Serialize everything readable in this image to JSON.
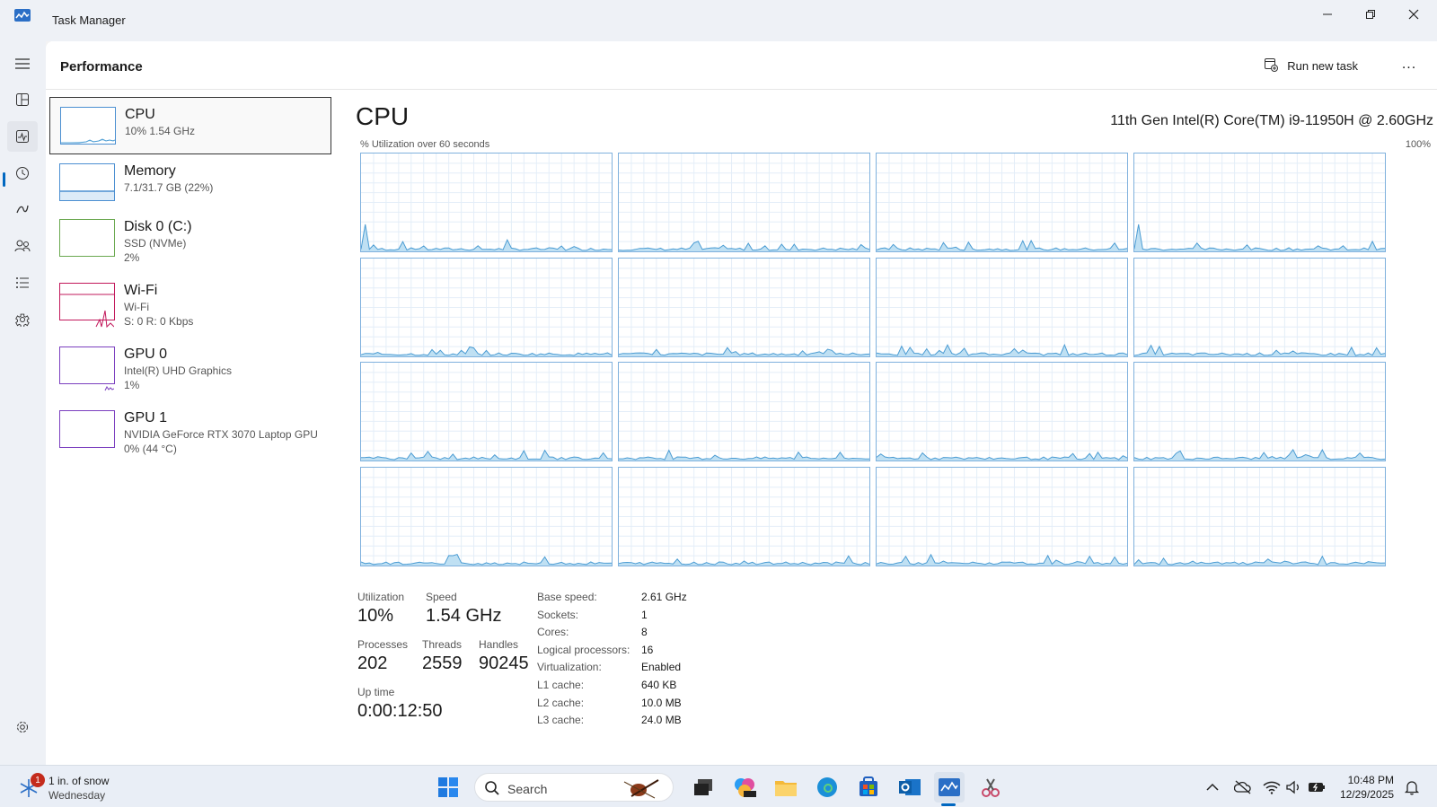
{
  "window": {
    "title": "Task Manager"
  },
  "header": {
    "page_title": "Performance",
    "run_new_task": "Run new task",
    "more": "..."
  },
  "resources": [
    {
      "name": "CPU",
      "line1": "10% 1.54 GHz",
      "line2": ""
    },
    {
      "name": "Memory",
      "line1": "7.1/31.7 GB (22%)",
      "line2": ""
    },
    {
      "name": "Disk 0 (C:)",
      "line1": "SSD (NVMe)",
      "line2": "2%"
    },
    {
      "name": "Wi-Fi",
      "line1": "Wi-Fi",
      "line2": "S: 0 R: 0 Kbps"
    },
    {
      "name": "GPU 0",
      "line1": "Intel(R) UHD Graphics",
      "line2": "1%"
    },
    {
      "name": "GPU 1",
      "line1": "NVIDIA GeForce RTX 3070 Laptop GPU",
      "line2": "0% (44 °C)"
    }
  ],
  "details": {
    "title": "CPU",
    "model": "11th Gen Intel(R) Core(TM) i9-11950H @ 2.60GHz",
    "graph_caption": "% Utilization over 60 seconds",
    "graph_max": "100%",
    "stats": {
      "utilization_label": "Utilization",
      "utilization": "10%",
      "speed_label": "Speed",
      "speed": "1.54 GHz",
      "processes_label": "Processes",
      "processes": "202",
      "threads_label": "Threads",
      "threads": "2559",
      "handles_label": "Handles",
      "handles": "90245",
      "uptime_label": "Up time",
      "uptime": "0:00:12:50"
    },
    "specs": [
      {
        "key": "Base speed:",
        "value": "2.61 GHz"
      },
      {
        "key": "Sockets:",
        "value": "1"
      },
      {
        "key": "Cores:",
        "value": "8"
      },
      {
        "key": "Logical processors:",
        "value": "16"
      },
      {
        "key": "Virtualization:",
        "value": "Enabled"
      },
      {
        "key": "L1 cache:",
        "value": "640 KB"
      },
      {
        "key": "L2 cache:",
        "value": "10.0 MB"
      },
      {
        "key": "L3 cache:",
        "value": "24.0 MB"
      }
    ]
  },
  "taskbar": {
    "weather_badge": "1",
    "weather_temp": "1 in. of snow",
    "weather_day": "Wednesday",
    "search_placeholder": "Search",
    "time": "10:48 PM",
    "date": "12/29/2025"
  },
  "colors": {
    "accent": "#0067c0",
    "graph_line": "#4b9cd3",
    "graph_fill": "#bfe0f3"
  }
}
